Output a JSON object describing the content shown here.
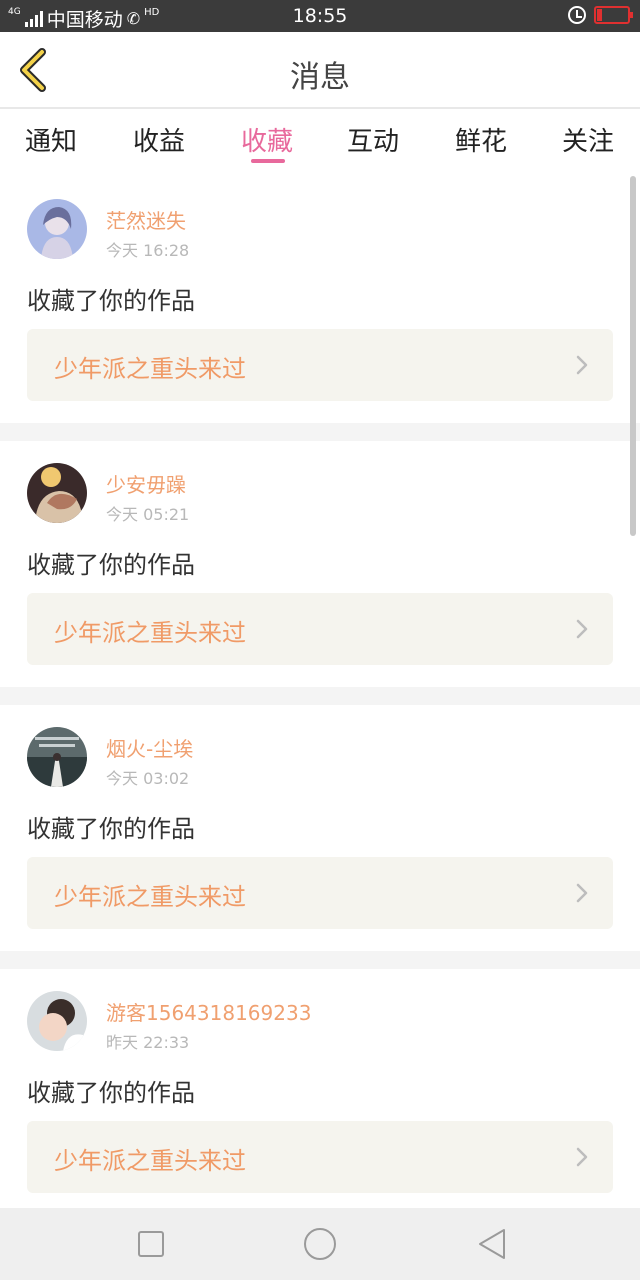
{
  "status_bar": {
    "network": "4G",
    "carrier": "中国移动",
    "hd": "HD",
    "time": "18:55",
    "battery_level": 0.15,
    "battery_color": "#e03030"
  },
  "header": {
    "back_icon": "chevron-left-icon",
    "title": "消息"
  },
  "tabs": [
    {
      "label": "通知",
      "active": false
    },
    {
      "label": "收益",
      "active": false
    },
    {
      "label": "收藏",
      "active": true
    },
    {
      "label": "互动",
      "active": false
    },
    {
      "label": "鲜花",
      "active": false
    },
    {
      "label": "关注",
      "active": false
    }
  ],
  "accent_color": "#e8699c",
  "messages": [
    {
      "username": "茫然迷失",
      "time": "今天 16:28",
      "action": "收藏了你的作品",
      "work_title": "少年派之重头来过"
    },
    {
      "username": "少安毋躁",
      "time": "今天 05:21",
      "action": "收藏了你的作品",
      "work_title": "少年派之重头来过"
    },
    {
      "username": "烟火-尘埃",
      "time": "今天 03:02",
      "action": "收藏了你的作品",
      "work_title": "少年派之重头来过"
    },
    {
      "username": "游客1564318169233",
      "time": "昨天 22:33",
      "action": "收藏了你的作品",
      "work_title": "少年派之重头来过"
    }
  ],
  "nav": {
    "recent_icon": "square-icon",
    "home_icon": "circle-icon",
    "back_icon": "triangle-back-icon"
  }
}
